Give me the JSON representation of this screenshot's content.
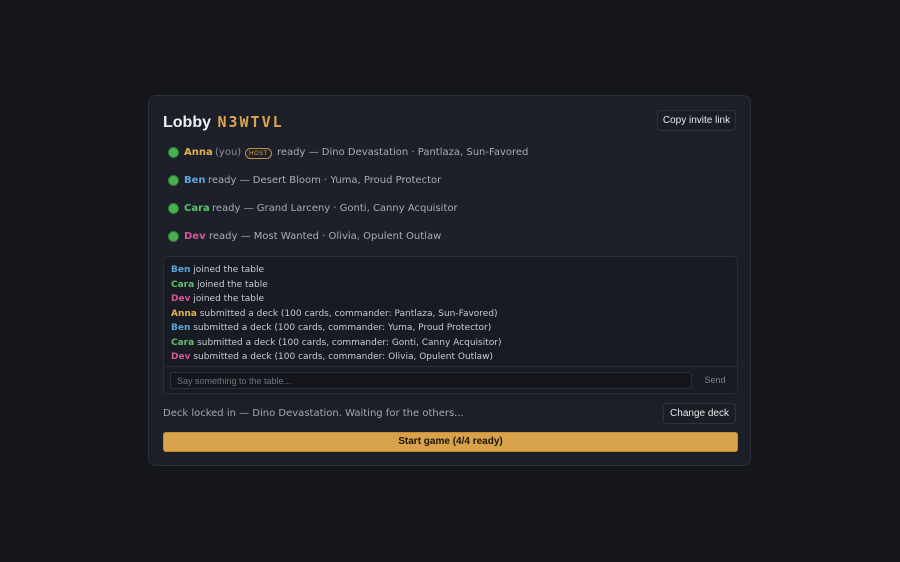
{
  "lobby": {
    "title_label": "Lobby",
    "code": "N3WTVL",
    "copy_invite_label": "Copy invite link"
  },
  "colors": {
    "Anna": "#e3b34f",
    "Ben": "#5aa7dc",
    "Cara": "#5fc16e",
    "Dev": "#d5569b",
    "ready_dot": "#4caf50",
    "accent": "#d8a24a"
  },
  "players": [
    {
      "name": "Anna",
      "you": "(you)",
      "host": "HOST",
      "info": "ready — Dino Devastation · Pantlaza, Sun-Favored"
    },
    {
      "name": "Ben",
      "info": "ready — Desert Bloom · Yuma, Proud Protector"
    },
    {
      "name": "Cara",
      "info": "ready — Grand Larceny · Gonti, Canny Acquisitor"
    },
    {
      "name": "Dev",
      "info": "ready — Most Wanted · Olivia, Opulent Outlaw"
    }
  ],
  "log": [
    {
      "name": "Ben",
      "text": " joined the table"
    },
    {
      "name": "Cara",
      "text": " joined the table"
    },
    {
      "name": "Dev",
      "text": " joined the table"
    },
    {
      "name": "Anna",
      "text": " submitted a deck (100 cards, commander: Pantlaza, Sun-Favored)"
    },
    {
      "name": "Ben",
      "text": " submitted a deck (100 cards, commander: Yuma, Proud Protector)"
    },
    {
      "name": "Cara",
      "text": " submitted a deck (100 cards, commander: Gonti, Canny Acquisitor)"
    },
    {
      "name": "Dev",
      "text": " submitted a deck (100 cards, commander: Olivia, Opulent Outlaw)"
    }
  ],
  "chat": {
    "placeholder": "Say something to the table...",
    "send_label": "Send"
  },
  "status": {
    "text": "Deck locked in — Dino Devastation. Waiting for the others...",
    "change_deck_label": "Change deck"
  },
  "start": {
    "label": "Start game (4/4 ready)"
  }
}
